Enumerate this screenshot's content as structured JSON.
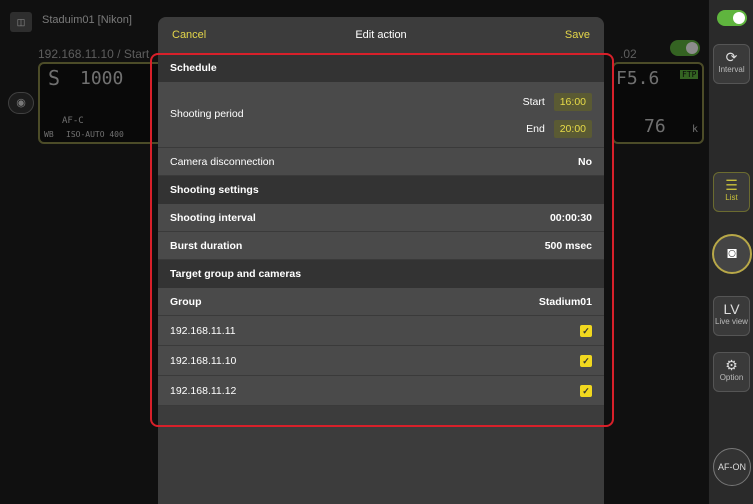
{
  "background": {
    "camera_name": "Staduim01 [Nikon]",
    "address_left": "192.168.11.10 / Start",
    "address_right": ".02",
    "shutter_speed": "1000",
    "mode": "S",
    "aperture": "F5.6",
    "af_mode": "AF-C",
    "iso": "ISO-AUTO 400",
    "wb": "WB",
    "ftp": "FTP",
    "remaining": "76",
    "remaining_unit": "k"
  },
  "sidebar": {
    "interval_label": "Interval",
    "list_label": "List",
    "lv_icon": "LV",
    "lv_label": "Live view",
    "option_label": "Option",
    "af_on_label": "AF-ON"
  },
  "modal": {
    "cancel_label": "Cancel",
    "title": "Edit action",
    "save_label": "Save",
    "schedule": {
      "heading": "Schedule",
      "shooting_period_label": "Shooting period",
      "start_label": "Start",
      "start_value": "16:00",
      "end_label": "End",
      "end_value": "20:00",
      "camera_disconnection_label": "Camera disconnection",
      "camera_disconnection_value": "No"
    },
    "shooting_settings": {
      "heading": "Shooting settings",
      "interval_label": "Shooting interval",
      "interval_value": "00:00:30",
      "burst_label": "Burst duration",
      "burst_value": "500 msec"
    },
    "target": {
      "heading": "Target group and cameras",
      "group_label": "Group",
      "group_value": "Stadium01",
      "cameras": [
        "192.168.11.11",
        "192.168.11.10",
        "192.168.11.12"
      ]
    }
  },
  "colors": {
    "accent": "#e4d64a",
    "highlight": "#d8202a",
    "toggle": "#5fb53e"
  }
}
